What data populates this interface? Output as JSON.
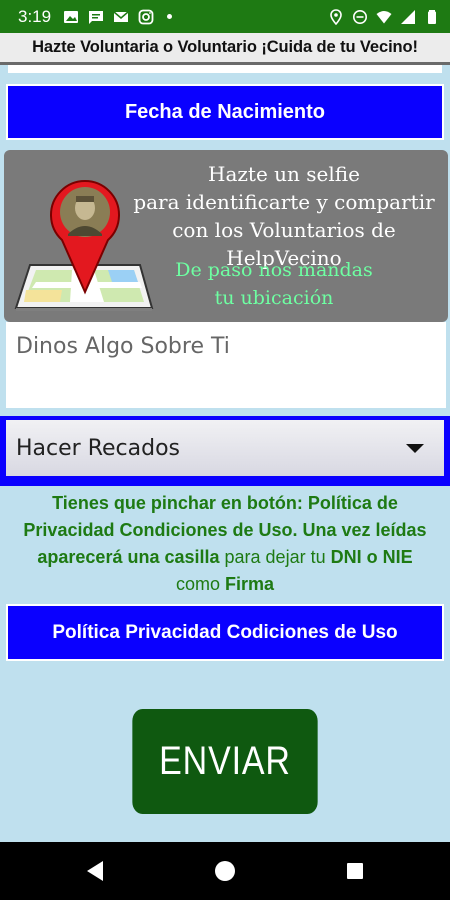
{
  "status_bar": {
    "time": "3:19",
    "left_icons": [
      "image-icon",
      "message-icon",
      "mail-icon",
      "instagram-icon"
    ],
    "right_icons": [
      "location-icon",
      "do-not-disturb-icon",
      "wifi-icon",
      "signal-icon",
      "battery-icon"
    ]
  },
  "app": {
    "title": "Hazte Voluntaria o Voluntario ¡Cuida de tu Vecino!"
  },
  "form": {
    "birth_date_label": "Fecha de Nacimiento",
    "selfie": {
      "line1": "Hazte un selfie",
      "line2": "para identificarte y compartir",
      "line3": "con los Voluntarios de HelpVecino",
      "line4": "De paso nos mandas",
      "line5": "tu ubicación"
    },
    "about_placeholder": "Dinos Algo Sobre Ti",
    "task_selected": "Hacer Recados",
    "notice": {
      "part1": "Tienes que pinchar en botón: Política de Privacidad Condiciones de Uso. Una vez leídas aparecerá una casilla",
      "part2": " para dejar tu ",
      "part3": "DNI o NIE",
      "part4": " como ",
      "part5": "Firma"
    },
    "privacy_button": "Política Privacidad Codiciones de Uso",
    "send_button": "ENVIAR"
  },
  "colors": {
    "status_bar": "#1e7a13",
    "background": "#bfe0ee",
    "blue_button": "#0a00ff",
    "send_button": "#0f5910",
    "notice_text": "#1e7a13",
    "selfie_green_text": "#6effa2"
  }
}
